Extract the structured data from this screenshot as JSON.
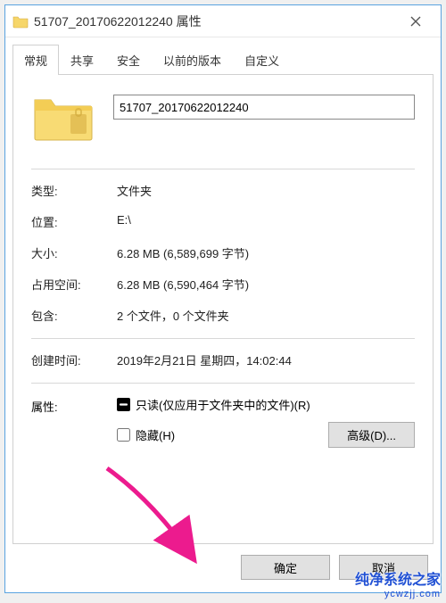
{
  "title": "51707_20170622012240 属性",
  "tabs": {
    "general": "常规",
    "sharing": "共享",
    "security": "安全",
    "previous": "以前的版本",
    "customize": "自定义"
  },
  "folder_name": "51707_20170622012240",
  "labels": {
    "type": "类型:",
    "location": "位置:",
    "size": "大小:",
    "size_on_disk": "占用空间:",
    "contains": "包含:",
    "created": "创建时间:",
    "attributes": "属性:"
  },
  "values": {
    "type": "文件夹",
    "location": "E:\\",
    "size": "6.28 MB (6,589,699 字节)",
    "size_on_disk": "6.28 MB (6,590,464 字节)",
    "contains": "2 个文件，0 个文件夹",
    "created": "2019年2月21日 星期四，14:02:44"
  },
  "attributes": {
    "readonly": "只读(仅应用于文件夹中的文件)(R)",
    "hidden": "隐藏(H)"
  },
  "buttons": {
    "advanced": "高级(D)...",
    "ok": "确定",
    "cancel": "取消"
  },
  "watermark": {
    "line1": "纯净系统之家",
    "line2": "ycwzjj.com"
  }
}
